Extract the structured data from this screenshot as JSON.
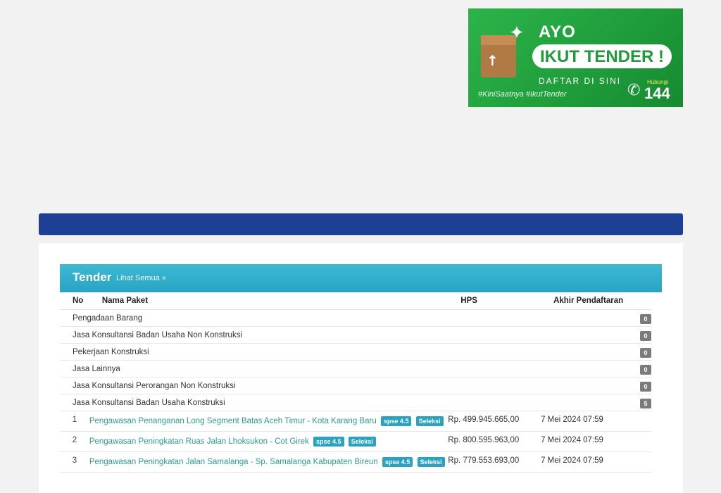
{
  "banner": {
    "ayo": "AYO",
    "headline": "IKUT TENDER !",
    "subline": "DAFTAR DI SINI",
    "hashtag": "#KiniSaatnya #IkutTender",
    "hubungi": "Hubungi",
    "phone": "144",
    "color_bg": "#1e9c3a"
  },
  "section": {
    "title": "Tender",
    "see_all": "Lihat Semua »"
  },
  "table": {
    "headers": [
      "No",
      "Nama Paket",
      "HPS",
      "Akhir Pendaftaran"
    ],
    "categories": [
      {
        "name": "Pengadaan Barang",
        "count": "0"
      },
      {
        "name": "Jasa Konsultansi Badan Usaha Non Konstruksi",
        "count": "0"
      },
      {
        "name": "Pekerjaan Konstruksi",
        "count": "0"
      },
      {
        "name": "Jasa Lainnya",
        "count": "0"
      },
      {
        "name": "Jasa Konsultansi Perorangan Non Konstruksi",
        "count": "0"
      },
      {
        "name": "Jasa Konsultansi Badan Usaha Konstruksi",
        "count": "5"
      }
    ],
    "items": [
      {
        "no": "1",
        "name": "Pengawasan Penanganan Long Segment Batas Aceh Timur - Kota Karang Baru",
        "tag1": "spse 4.5",
        "tag2": "Seleksi",
        "hps": "Rp. 499.945.665,00",
        "deadline": "7 Mei 2024 07:59"
      },
      {
        "no": "2",
        "name": "Pengawasan Peningkatan Ruas Jalan Lhoksukon - Cot Girek",
        "tag1": "spse 4.5",
        "tag2": "Seleksi",
        "hps": "Rp. 800.595.963,00",
        "deadline": "7 Mei 2024 07:59"
      },
      {
        "no": "3",
        "name": "Pengawasan Peningkatan Jalan Samalanga - Sp. Samalanga Kabupaten Bireun",
        "tag1": "spse 4.5",
        "tag2": "Seleksi",
        "hps": "Rp. 779.553.693,00",
        "deadline": "7 Mei 2024 07:59"
      }
    ]
  }
}
